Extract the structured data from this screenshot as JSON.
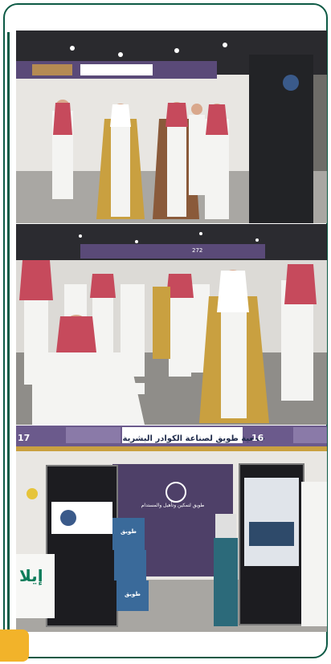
{
  "colors": {
    "frame": "#0d5a45",
    "badge": "#f2b32a",
    "booth_purple": "#5a4a78",
    "thobe_gold": "#c9a040"
  },
  "photos": [
    {
      "id": "tour-walking"
    },
    {
      "id": "exhibition-visit",
      "signs": {
        "booth_272": "272"
      }
    },
    {
      "id": "booth-16",
      "signs": {
        "title": "جمعية طويق لصناعة الكوادر البشرية",
        "booth_16": "16",
        "booth_17": "17",
        "banner": "طويق لتمكين وتأهيل والمستدام",
        "box_1": "طويق",
        "box_2": "طويق",
        "logo": "إيلا"
      }
    }
  ],
  "icons": [
    "booth-logo-icon"
  ]
}
